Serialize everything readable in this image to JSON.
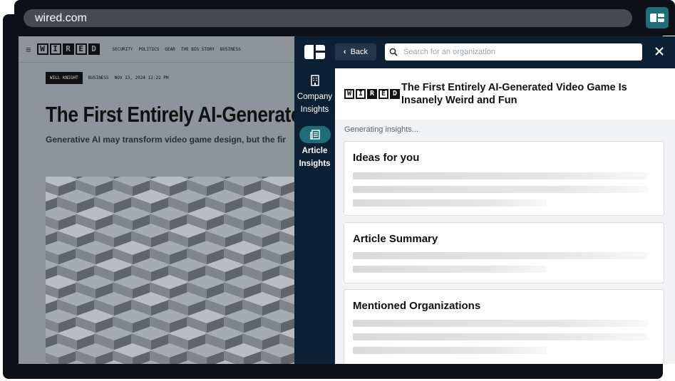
{
  "browser": {
    "url": "wired.com"
  },
  "website": {
    "nav_links": [
      "SECURITY",
      "POLITICS",
      "GEAR",
      "THE BIG STORY",
      "BUSINESS"
    ],
    "logo_letters": [
      "W",
      "I",
      "R",
      "E",
      "D"
    ],
    "author_tag": "WILL KNIGHT",
    "section": "BUSINESS",
    "date": "NOV 13, 2024 12:22 PM",
    "headline": "The First Entirely AI-Generate",
    "dek": "Generative AI may transform video game design, but the fir"
  },
  "panel": {
    "back_label": "Back",
    "search_placeholder": "Search for an organization",
    "sidebar": {
      "company_label": "Company Insights",
      "article_label": "Article Insights"
    },
    "article_title": "The First Entirely AI-Generated Video Game Is Insanely Weird and Fun",
    "status": "Generating insights...",
    "cards": [
      {
        "title": "Ideas for you"
      },
      {
        "title": "Article Summary"
      },
      {
        "title": "Mentioned Organizations"
      }
    ]
  },
  "icons": {
    "extension": "extension-logo-icon",
    "search": "search-icon",
    "close": "close-icon",
    "back": "chevron-left-icon",
    "company": "building-icon",
    "article": "article-icon"
  },
  "colors": {
    "accent": "#1d6e79",
    "panel_dark": "#0d1f33",
    "frame": "#0d1117"
  }
}
